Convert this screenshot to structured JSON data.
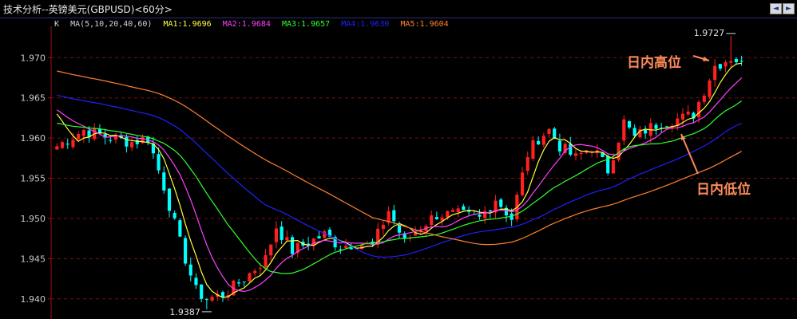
{
  "title": "技术分析--英镑美元(GBPUSD)<60分>",
  "toolbar": {
    "prev_icon": "arrow-left-icon",
    "next_icon": "arrow-right-icon"
  },
  "ma_legend": {
    "k": "K",
    "ma": "MA(5,10,20,40,60)",
    "ma1": "MA1:1.9696",
    "ma2": "MA2:1.9684",
    "ma3": "MA3:1.9657",
    "ma4": "MA4:1.9630",
    "ma5": "MA5:1.9604"
  },
  "colors": {
    "background": "#000000",
    "up": "#ff2020",
    "down": "#00ffff",
    "grid": "#7a1010",
    "axis": "#a01010",
    "ma1": "#ffff40",
    "ma2": "#ff40ff",
    "ma3": "#30ff30",
    "ma4": "#2020ff",
    "ma5": "#ff8030",
    "annotation": "#ff8c5a"
  },
  "chart_data": {
    "type": "candlestick",
    "title": "技术分析--英镑美元(GBPUSD)<60分>",
    "ylim": [
      1.9375,
      1.9735
    ],
    "grid": true,
    "y_ticks": [
      "1.940",
      "1.945",
      "1.950",
      "1.955",
      "1.960",
      "1.965",
      "1.970"
    ],
    "y_tick_values": [
      1.94,
      1.945,
      1.95,
      1.955,
      1.96,
      1.965,
      1.97
    ],
    "high_label": "1.9727",
    "low_label": "1.9387",
    "high_value": 1.9727,
    "low_value": 1.9387,
    "annotations": [
      {
        "text": "日内高位",
        "target": "high"
      },
      {
        "text": "日内低位",
        "target": "low"
      }
    ],
    "anchors": [
      [
        0,
        1.959
      ],
      [
        5,
        1.961
      ],
      [
        10,
        1.96
      ],
      [
        14,
        1.9595
      ],
      [
        17,
        1.96
      ],
      [
        20,
        1.954
      ],
      [
        23,
        1.947
      ],
      [
        26,
        1.941
      ],
      [
        28,
        1.94
      ],
      [
        31,
        1.9405
      ],
      [
        35,
        1.9425
      ],
      [
        39,
        1.945
      ],
      [
        41,
        1.949
      ],
      [
        44,
        1.946
      ],
      [
        47,
        1.947
      ],
      [
        50,
        1.948
      ],
      [
        53,
        1.9465
      ],
      [
        56,
        1.947
      ],
      [
        59,
        1.9465
      ],
      [
        62,
        1.951
      ],
      [
        65,
        1.947
      ],
      [
        68,
        1.949
      ],
      [
        71,
        1.9505
      ],
      [
        75,
        1.9505
      ],
      [
        79,
        1.95
      ],
      [
        82,
        1.9525
      ],
      [
        85,
        1.95
      ],
      [
        88,
        1.958
      ],
      [
        90,
        1.96
      ],
      [
        92,
        1.961
      ],
      [
        94,
        1.959
      ],
      [
        97,
        1.9575
      ],
      [
        100,
        1.959
      ],
      [
        103,
        1.956
      ],
      [
        106,
        1.962
      ],
      [
        108,
        1.96
      ],
      [
        110,
        1.961
      ],
      [
        113,
        1.962
      ],
      [
        117,
        1.9625
      ],
      [
        119,
        1.963
      ],
      [
        121,
        1.966
      ],
      [
        123,
        1.969
      ],
      [
        126,
        1.97
      ],
      [
        128,
        1.9695
      ]
    ]
  }
}
